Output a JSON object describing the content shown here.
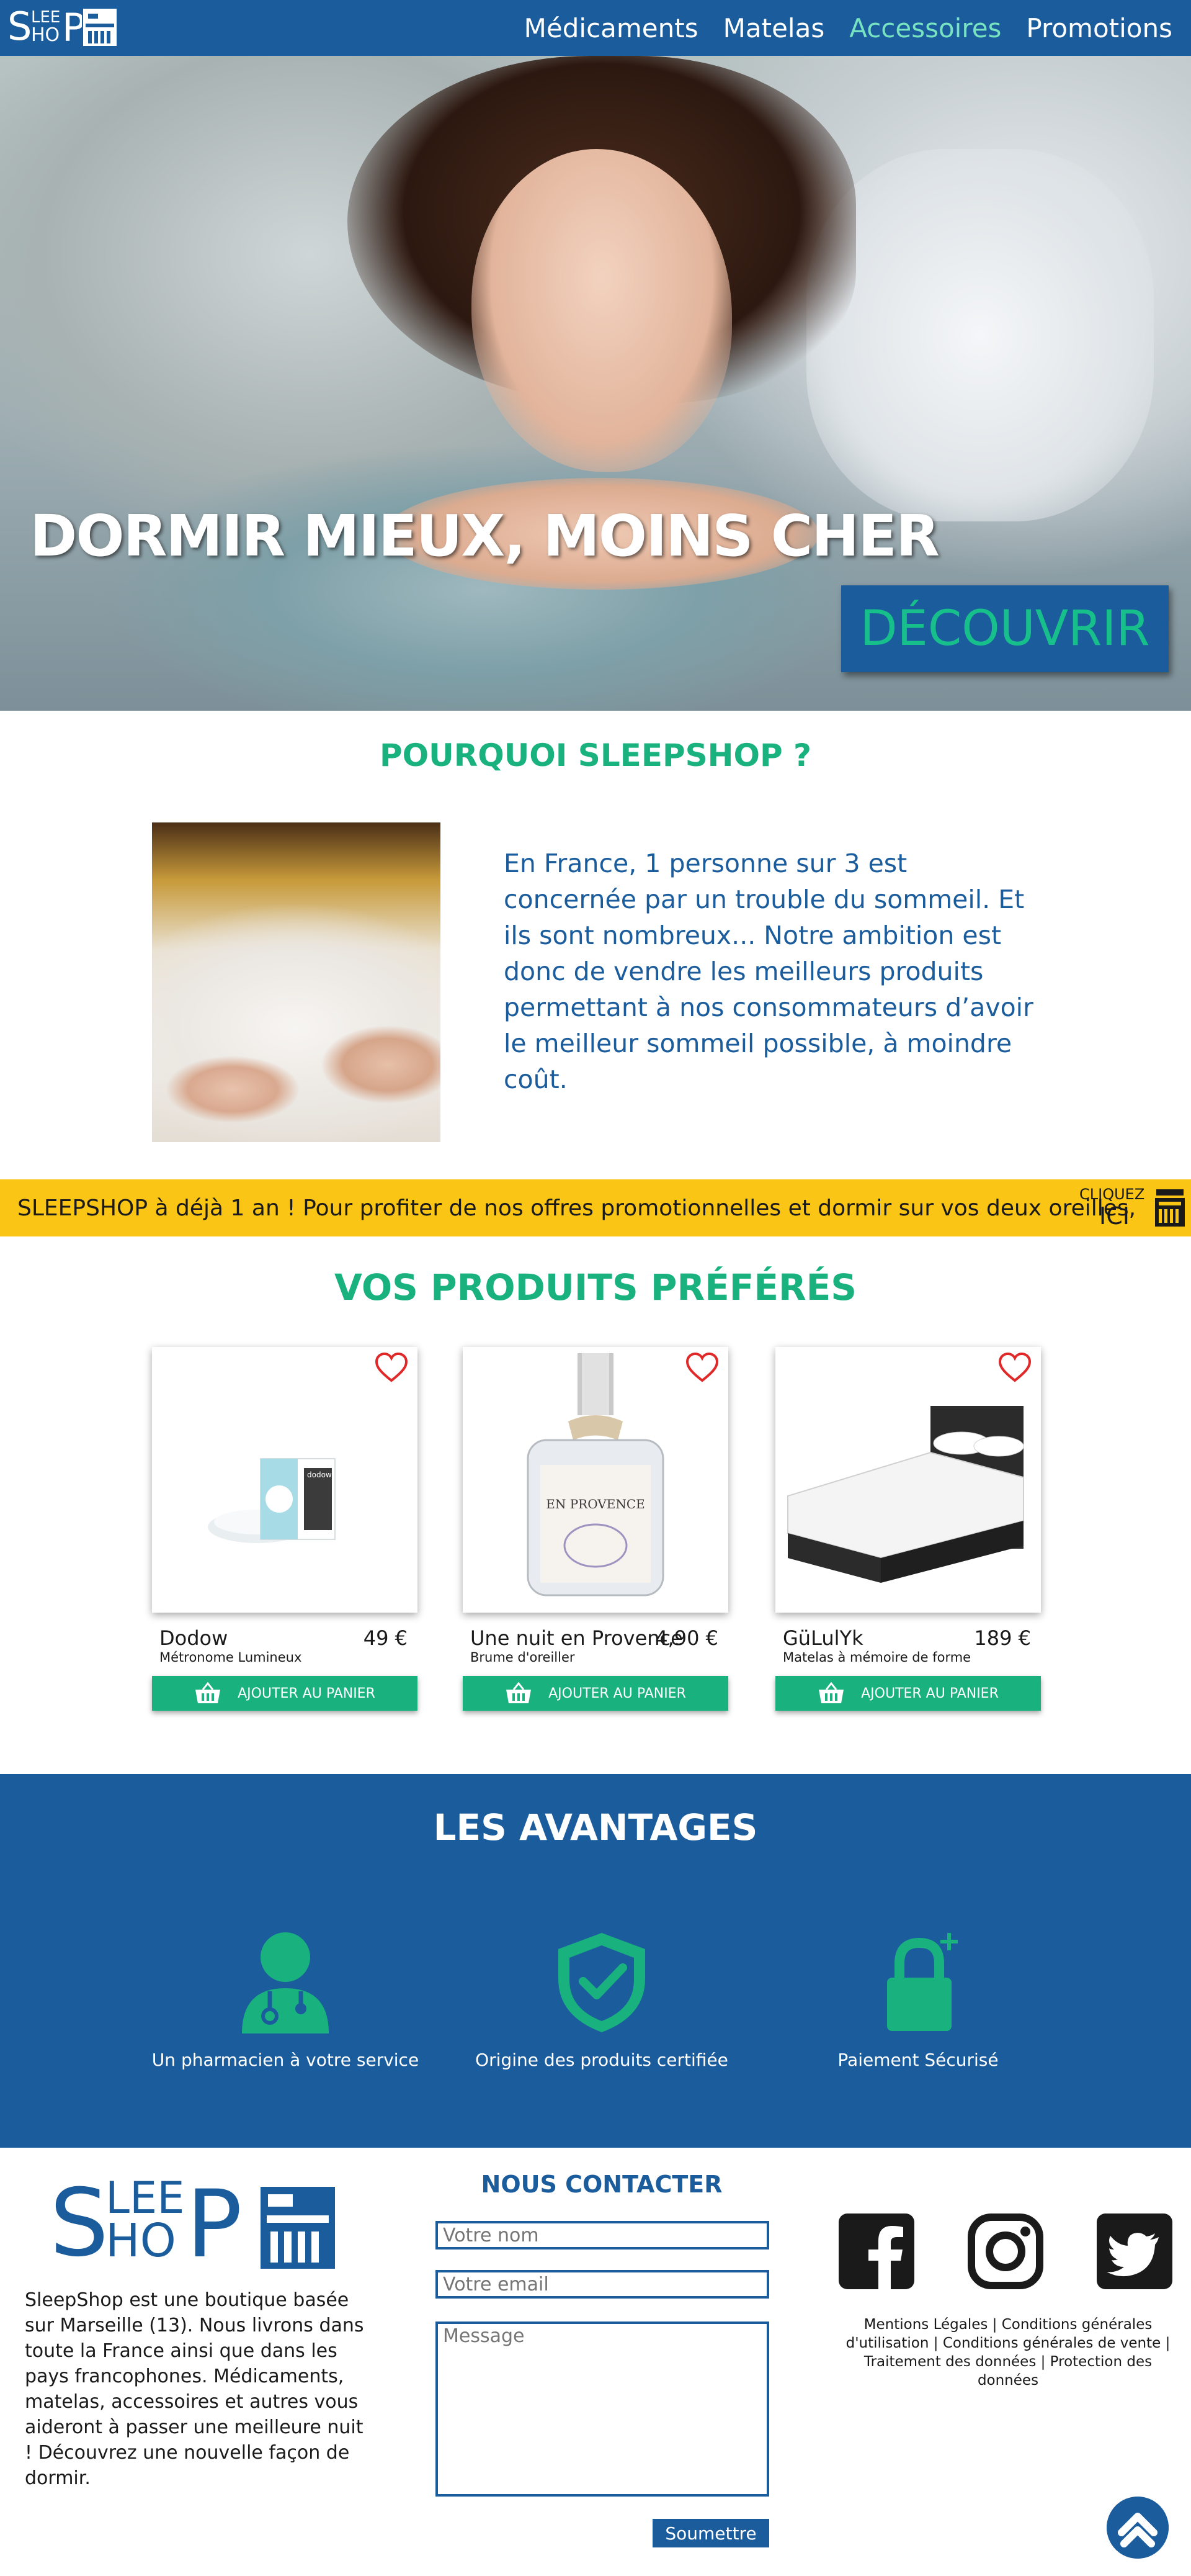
{
  "brand": {
    "name": "SleepShop",
    "logo_text": "SLEEP SHOP"
  },
  "nav": {
    "items": [
      {
        "label": "Médicaments",
        "active": false
      },
      {
        "label": "Matelas",
        "active": false
      },
      {
        "label": "Accessoires",
        "active": true
      },
      {
        "label": "Promotions",
        "active": false
      }
    ]
  },
  "hero": {
    "headline": "DORMIR MIEUX, MOINS CHER",
    "cta_label": "DÉCOUVRIR"
  },
  "why": {
    "title": "POURQUOI SLEEPSHOP ?",
    "text": "En France, 1 personne sur 3 est concernée par un trouble du sommeil. Et ils sont nombreux... Notre ambition est donc de vendre les meilleurs produits permettant à nos consommateurs d’avoir le meilleur sommeil possible, à moindre coût."
  },
  "banner": {
    "message": "SLEEPSHOP à déjà 1 an ! Pour profiter de nos offres promotionnelles et dormir sur vos deux oreilles,",
    "click_line1": "CLIQUEZ",
    "click_line2": "ICI"
  },
  "products": {
    "title": "VOS PRODUITS PRÉFÉRÉS",
    "add_label": "AJOUTER AU PANIER",
    "items": [
      {
        "name": "Dodow",
        "subtitle": "Métronome Lumineux",
        "price": "49 €",
        "image_text": "dodow"
      },
      {
        "name": "Une nuit en Provence",
        "subtitle": "Brume d'oreiller",
        "price": "4,90 €",
        "image_text": "EN PROVENCE"
      },
      {
        "name": "GüLulYk",
        "subtitle": "Matelas à mémoire de forme",
        "price": "189 €",
        "image_text": ""
      }
    ]
  },
  "advantages": {
    "title": "LES AVANTAGES",
    "items": [
      {
        "label": "Un pharmacien à votre service",
        "icon": "doctor-icon"
      },
      {
        "label": "Origine des produits certifiée",
        "icon": "shield-check-icon"
      },
      {
        "label": "Paiement Sécurisé",
        "icon": "lock-icon"
      }
    ]
  },
  "footer": {
    "about": "SleepShop est une boutique basée sur Marseille (13). Nous livrons dans toute la France ainsi que dans les pays francophones. Médicaments, matelas, accessoires et autres vous aideront à passer une meilleure nuit ! Découvrez une nouvelle façon de dormir.",
    "contact": {
      "title": "NOUS CONTACTER",
      "name_placeholder": "Votre nom",
      "email_placeholder": "Votre email",
      "message_placeholder": "Message",
      "submit_label": "Soumettre"
    },
    "social": [
      "facebook-icon",
      "instagram-icon",
      "twitter-icon"
    ],
    "legal": "Mentions Légales | Conditions générales d'utilisation | Conditions générales de vente | Traitement des données | Protection des données"
  },
  "colors": {
    "primary": "#1b5c9c",
    "accent": "#19b27f",
    "banner": "#fac515",
    "nav_active": "#77e3c1"
  }
}
